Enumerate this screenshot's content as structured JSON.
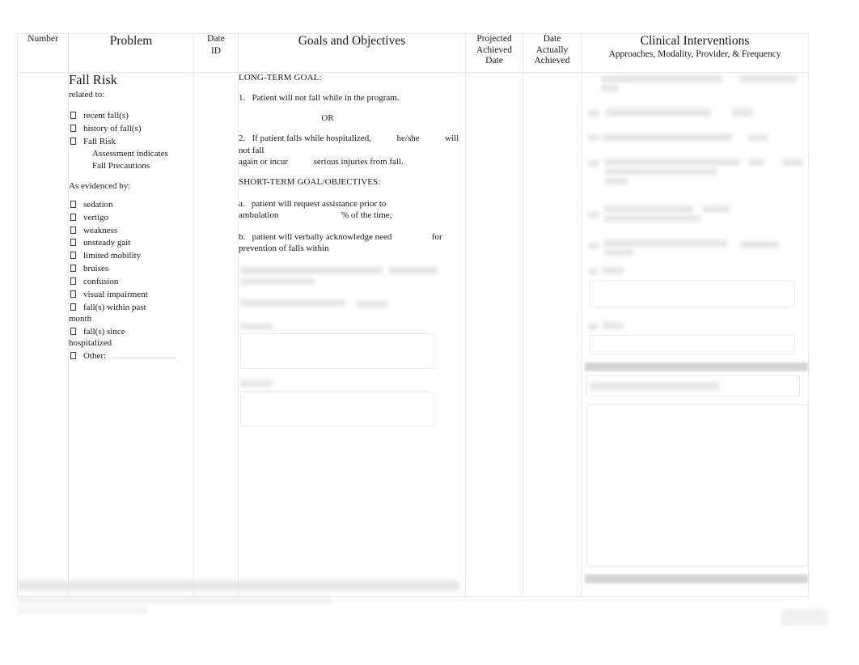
{
  "document": {
    "type": "clinical-care-plan-table",
    "page_background": "#ffffff",
    "border_color": "#e9e9e9"
  },
  "table": {
    "headers": [
      {
        "id": "number",
        "label": "Number",
        "size": "small"
      },
      {
        "id": "problem",
        "label": "Problem",
        "size": "big"
      },
      {
        "id": "date_id",
        "label": "Date",
        "sublabel": "ID",
        "size": "small"
      },
      {
        "id": "goals",
        "label": "Goals and Objectives",
        "size": "big"
      },
      {
        "id": "projected_achieved_date",
        "line1": "Projected",
        "line2": "Achieved",
        "line3": "Date",
        "size": "small"
      },
      {
        "id": "date_actually_achieved",
        "line1": "Date",
        "line2": "Actually",
        "line3": "Achieved",
        "size": "small"
      },
      {
        "id": "clinical_interventions",
        "label": "Clinical Interventions",
        "sublabel": "Approaches, Modality, Provider, & Frequency",
        "size": "big"
      }
    ]
  },
  "row": {
    "number_value": "",
    "date_id_value": "",
    "projected_date_value": "",
    "date_achieved_value": ""
  },
  "problem": {
    "title": "Fall Risk",
    "related_to_label": "related to:",
    "related_to_items": [
      {
        "text": "recent  fall(s)"
      },
      {
        "text": "history of  fall(s)"
      },
      {
        "text": "Fall Risk",
        "sub1": "Assessment       indicates",
        "sub2": "Fall Precautions"
      }
    ],
    "evidenced_by_label": "As evidenced by:",
    "evidenced_by_items": [
      {
        "text": "sedation"
      },
      {
        "text": "vertigo"
      },
      {
        "text": "weakness"
      },
      {
        "text": "unsteady gait"
      },
      {
        "text": "limited mobility"
      },
      {
        "text": "bruises"
      },
      {
        "text": "confusion"
      },
      {
        "text": "visual impairment"
      },
      {
        "text": "fall(s) within past",
        "cont": "month"
      },
      {
        "text": "fall(s) since",
        "cont": "hospitalized"
      },
      {
        "text": "Other:",
        "rule": true
      }
    ]
  },
  "goals": {
    "long_term_heading": "LONG-TERM GOAL:",
    "long_term_items": [
      {
        "marker": "1.",
        "text": "Patient will not fall while in the program."
      },
      {
        "marker": "2.",
        "text_a": "If patient falls while hospitalized,",
        "text_b": "he/she",
        "text_c": "will not fall",
        "text_d": "again or incur",
        "text_e": "serious injuries from fall."
      }
    ],
    "or_label": "OR",
    "short_term_heading": "SHORT-TERM GOAL/OBJECTIVES:",
    "short_term_items": [
      {
        "marker": "a.",
        "text_a": "patient will request assistance prior to",
        "text_b": "ambulation",
        "text_c": "% of the time;"
      },
      {
        "marker": "b.",
        "text_a": "patient will verbally acknowledge need",
        "text_b": "for",
        "text_c": "prevention of falls within"
      }
    ],
    "redacted_note": "remaining goal text in source image is blurred and illegible"
  },
  "interventions": {
    "redacted_note": "all intervention text in source image is blurred and illegible",
    "shaded_row_color": "#d5d5d5"
  },
  "footer": {
    "redacted_note": "footer line in source image is blurred and illegible"
  }
}
